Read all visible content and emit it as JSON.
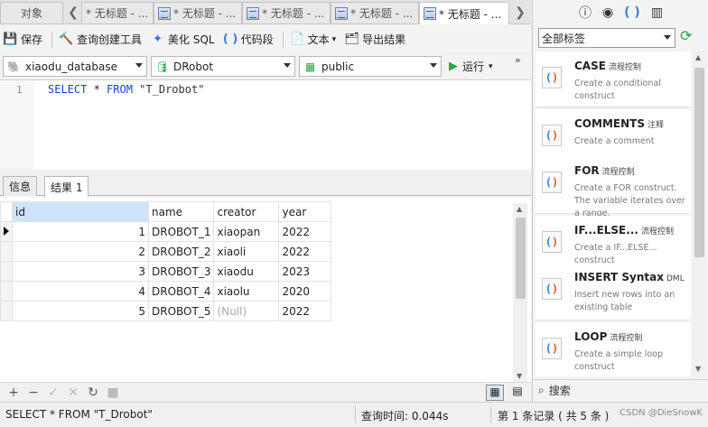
{
  "tabs": {
    "objects": "对象",
    "untitled": [
      "* 无标题 - ...",
      "* 无标题 - ...",
      "* 无标题 - ...",
      "* 无标题 - ...",
      "* 无标题 - ..."
    ],
    "active_index": 4
  },
  "toolbar": {
    "save": "保存",
    "query_builder": "查询创建工具",
    "beautify": "美化 SQL",
    "snippet": "代码段",
    "text": "文本",
    "export": "导出结果"
  },
  "connection": {
    "database": "xiaodu_database",
    "schema_db": "DRobot",
    "schema": "public",
    "run": "运行"
  },
  "editor": {
    "line_number": "1",
    "kw_select": "SELECT",
    "star": " * ",
    "kw_from": "FROM",
    "table": " \"T_Drobot\""
  },
  "result_tabs": {
    "info": "信息",
    "result": "结果 1"
  },
  "grid": {
    "columns": [
      "id",
      "name",
      "creator",
      "year"
    ],
    "rows": [
      [
        "1",
        "DROBOT_1",
        "xiaopan",
        "2022"
      ],
      [
        "2",
        "DROBOT_2",
        "xiaoli",
        "2022"
      ],
      [
        "3",
        "DROBOT_3",
        "xiaodu",
        "2023"
      ],
      [
        "4",
        "DROBOT_4",
        "xiaolu",
        "2020"
      ],
      [
        "5",
        "DROBOT_5",
        "(Null)",
        "2022"
      ]
    ]
  },
  "status": {
    "sql": "SELECT * FROM \"T_Drobot\"",
    "query_time": "查询时间: 0.044s",
    "record": "第 1 条记录 ( 共 5 条 )"
  },
  "side_panel": {
    "tag_filter": "全部标签",
    "search": "搜索",
    "snippets": [
      {
        "title": "CASE",
        "tag": "流程控制",
        "desc": "Create a conditional construct"
      },
      {
        "title": "COMMENTS",
        "tag": "注释",
        "desc": "Create a comment"
      },
      {
        "title": "FOR",
        "tag": "流程控制",
        "desc": "Create a FOR construct. The variable iterates over a range."
      },
      {
        "title": "IF...ELSE...",
        "tag": "流程控制",
        "desc": "Create a IF...ELSE... construct"
      },
      {
        "title": "INSERT Syntax",
        "tag": "DML",
        "desc": "Insert new rows into an existing table"
      },
      {
        "title": "LOOP",
        "tag": "流程控制",
        "desc": "Create a simple loop construct"
      }
    ]
  },
  "watermark": "CSDN @DieSnowK",
  "colors": {
    "keyword": "#1b3cd6",
    "header_selected": "#cfe4fb",
    "run_green": "#2aa540"
  }
}
